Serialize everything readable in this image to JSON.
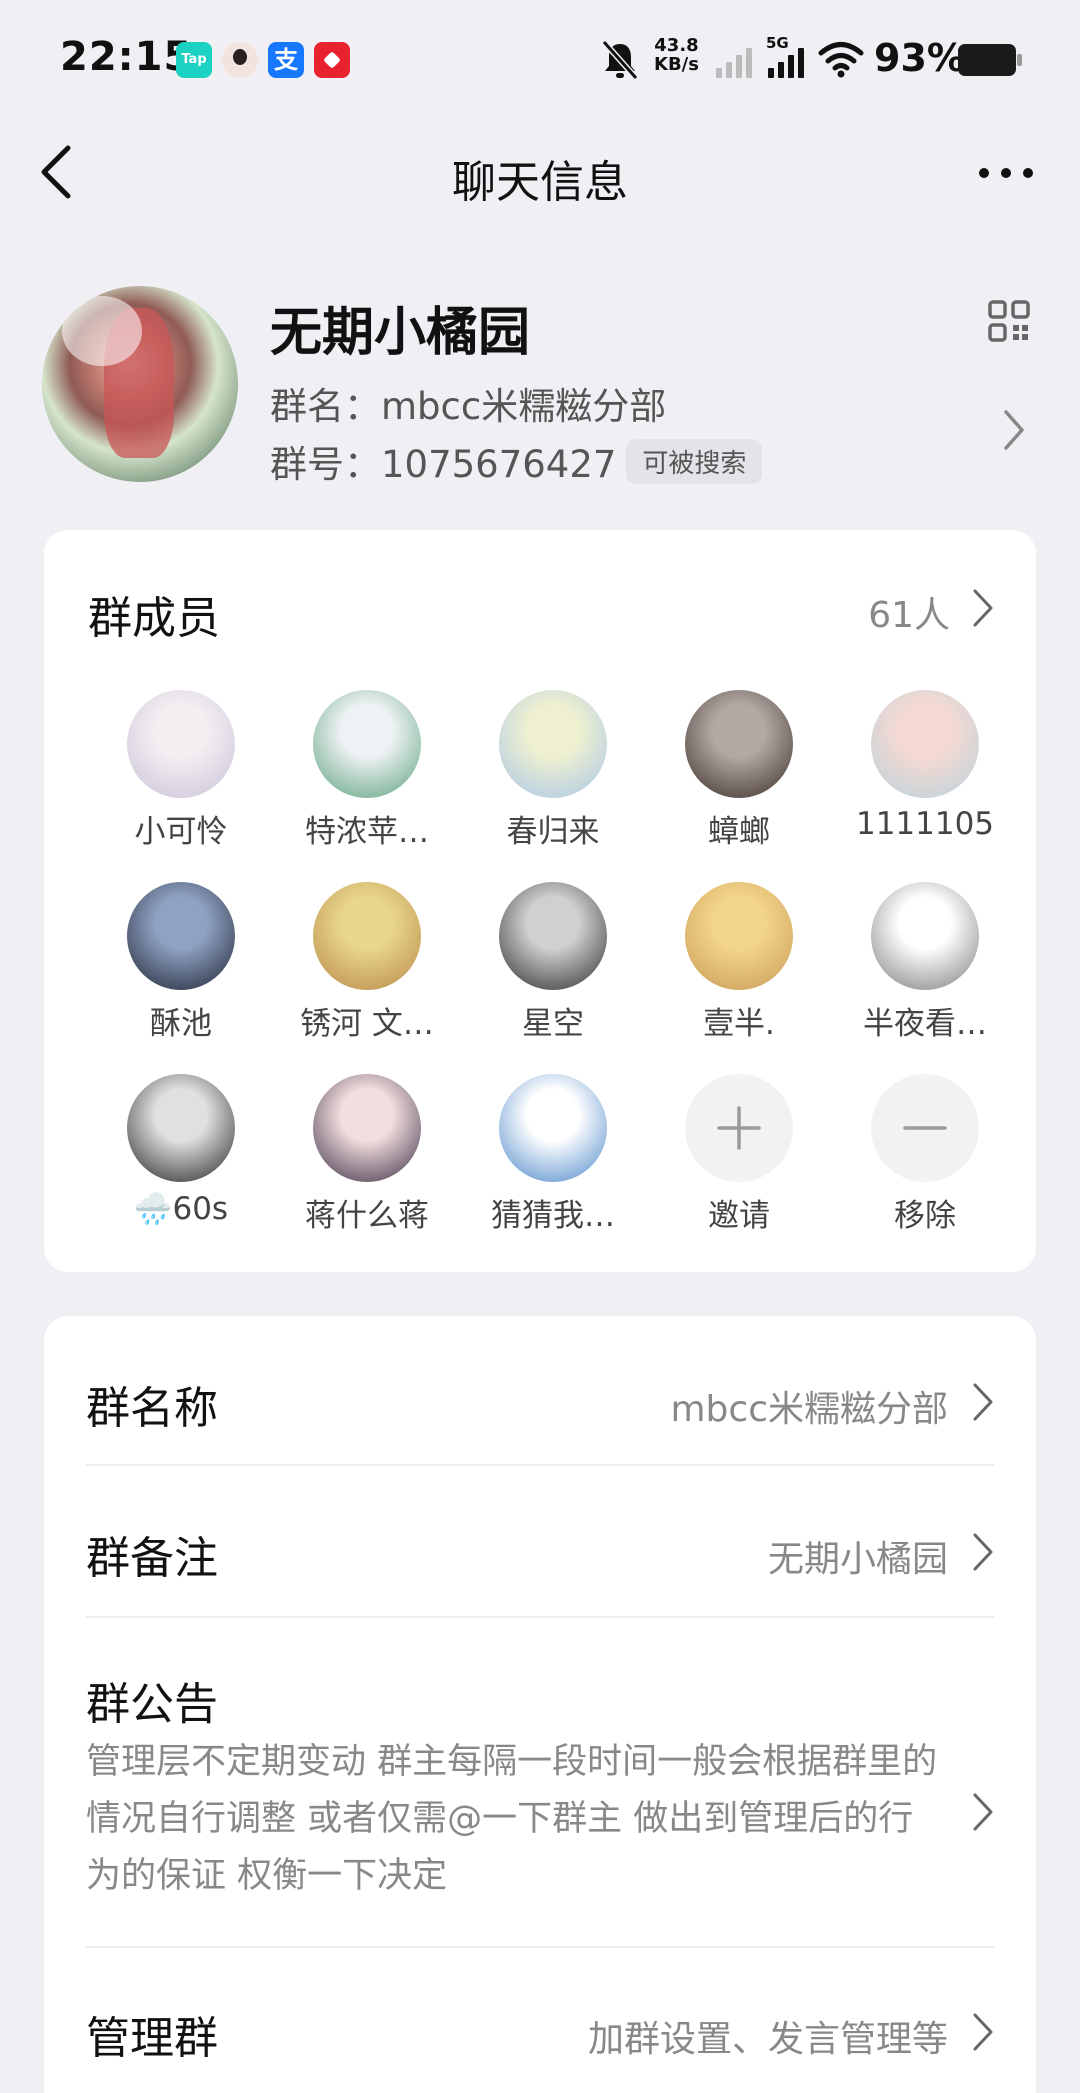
{
  "status_bar": {
    "time": "22:15",
    "tap_label": "Tap",
    "alipay_label": "支",
    "speed_value": "43.8",
    "speed_unit": "KB/s",
    "network": "5G",
    "battery": "93%",
    "icons": [
      "tap-app-icon",
      "avatar-app-icon",
      "alipay-icon",
      "red-app-icon",
      "bell-off-icon",
      "signal-icon",
      "wifi-icon",
      "battery-icon"
    ]
  },
  "nav": {
    "title": "聊天信息",
    "back_icon": "chevron-left-icon",
    "more_icon": "more-dots-icon"
  },
  "group": {
    "title": "无期小橘园",
    "name_label": "群名：",
    "name_value": "mbcc米糯糍分部",
    "id_label": "群号：",
    "id_value": "1075676427",
    "searchable": "可被搜索"
  },
  "members": {
    "title": "群成员",
    "count": "61人",
    "list": [
      {
        "name": "小可怜",
        "c1": "#f4eef2",
        "c2": "#c8c2d8"
      },
      {
        "name": "特浓苹…",
        "c1": "#eef2f4",
        "c2": "#5aa07a"
      },
      {
        "name": "春归来",
        "c1": "#eef0d0",
        "c2": "#a8c6e8"
      },
      {
        "name": "蟑螂",
        "c1": "#b3a9a4",
        "c2": "#3a2c28"
      },
      {
        "name": "1111105",
        "c1": "#f6d9d2",
        "c2": "#b8d2dc"
      },
      {
        "name": "酥池",
        "c1": "#8fa2c2",
        "c2": "#1e2232"
      },
      {
        "name": "锈河 文…",
        "c1": "#e8d68a",
        "c2": "#b88848"
      },
      {
        "name": "星空",
        "c1": "#d0d0d0",
        "c2": "#2a2a2a"
      },
      {
        "name": "壹半.",
        "c1": "#f2d58a",
        "c2": "#c99a56"
      },
      {
        "name": "半夜看…",
        "c1": "#ffffff",
        "c2": "#7a7a7a"
      },
      {
        "name": "🌧️60s",
        "c1": "#e0e0e0",
        "c2": "#222222"
      },
      {
        "name": "蒋什么蒋",
        "c1": "#f2dede",
        "c2": "#3a2c44"
      },
      {
        "name": "猜猜我…",
        "c1": "#ffffff",
        "c2": "#4a86c8"
      }
    ],
    "invite": "邀请",
    "remove": "移除"
  },
  "settings": {
    "group_name": {
      "label": "群名称",
      "value": "mbcc米糯糍分部"
    },
    "group_remark": {
      "label": "群备注",
      "value": "无期小橘园"
    },
    "announcement": {
      "label": "群公告",
      "text": "管理层不定期变动 群主每隔一段时间一般会根据群里的情况自行调整 或者仅需@一下群主 做出到管理后的行为的保证 权衡一下决定"
    },
    "admin": {
      "label": "管理群",
      "value": "加群设置、发言管理等"
    }
  }
}
